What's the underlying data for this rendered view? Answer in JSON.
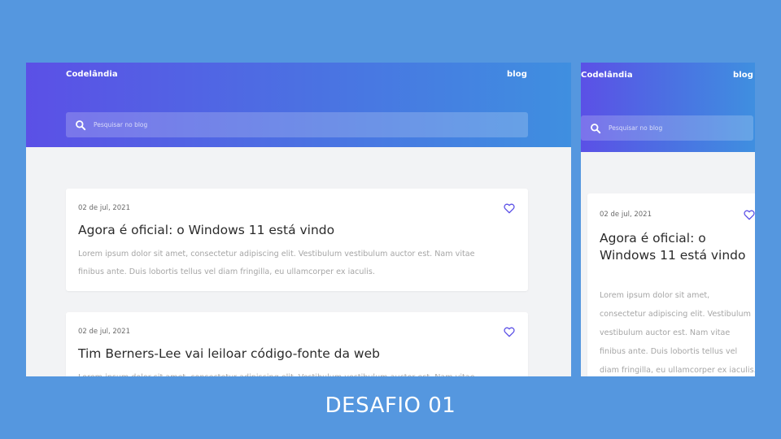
{
  "colors": {
    "background": "#5597df",
    "hero_gradient_start": "#5b50e6",
    "hero_gradient_end": "#3f8fe0",
    "accent": "#5b50e6",
    "content_bg": "#f2f3f5"
  },
  "site": {
    "brand": "Codelândia",
    "nav_link": "blog",
    "search_placeholder": "Pesquisar no blog"
  },
  "posts": [
    {
      "date": "02 de jul, 2021",
      "title": "Agora é oficial: o Windows 11 está vindo",
      "excerpt": "Lorem ipsum dolor sit amet, consectetur adipiscing elit. Vestibulum vestibulum auctor est. Nam vitae finibus ante. Duis lobortis tellus vel diam fringilla, eu ullamcorper ex iaculis.",
      "icon": "heart-outline-icon"
    },
    {
      "date": "02 de jul, 2021",
      "title": "Tim Berners-Lee vai leiloar código-fonte da web",
      "excerpt": "Lorem ipsum dolor sit amet, consectetur adipiscing elit. Vestibulum vestibulum auctor est. Nam vitae finibus ante.",
      "icon": "heart-outline-icon"
    }
  ],
  "footer": {
    "title": "DESAFIO 01"
  }
}
